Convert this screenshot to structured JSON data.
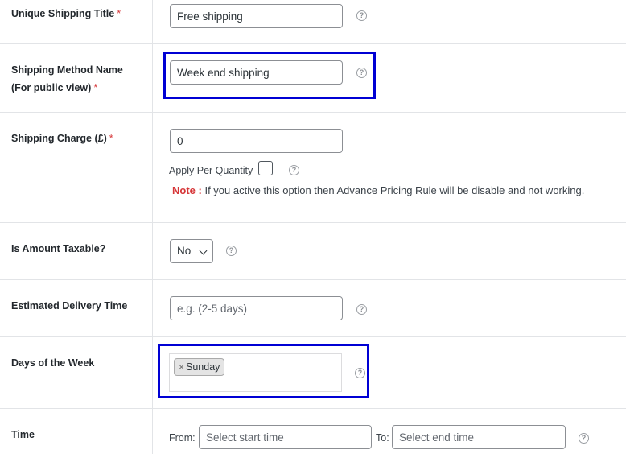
{
  "rows": {
    "unique_title": {
      "label": "Unique Shipping Title",
      "required": "*",
      "value": "Free shipping"
    },
    "method_name": {
      "label_line1": "Shipping Method Name",
      "label_line2": "(For public view)",
      "required": "*",
      "value": "Week end shipping"
    },
    "charge": {
      "label": "Shipping Charge (£)",
      "required": "*",
      "value": "0",
      "apply_per_quantity": "Apply Per Quantity",
      "note_tag": "Note :",
      "note_text": " If you active this option then Advance Pricing Rule will be disable and not working."
    },
    "taxable": {
      "label": "Is Amount Taxable?",
      "selected": "No"
    },
    "delivery": {
      "label": "Estimated Delivery Time",
      "placeholder": "e.g. (2-5 days)"
    },
    "days": {
      "label": "Days of the Week",
      "chip_remove": "×",
      "chip_label": "Sunday"
    },
    "time": {
      "label": "Time",
      "from_label": "From:",
      "from_placeholder": "Select start time",
      "to_label": "To:",
      "to_placeholder": "Select end time"
    }
  },
  "help_glyph": "?",
  "colors": {
    "highlight": "#0000d4",
    "required": "#d63638",
    "divider": "#e2e4e7"
  }
}
